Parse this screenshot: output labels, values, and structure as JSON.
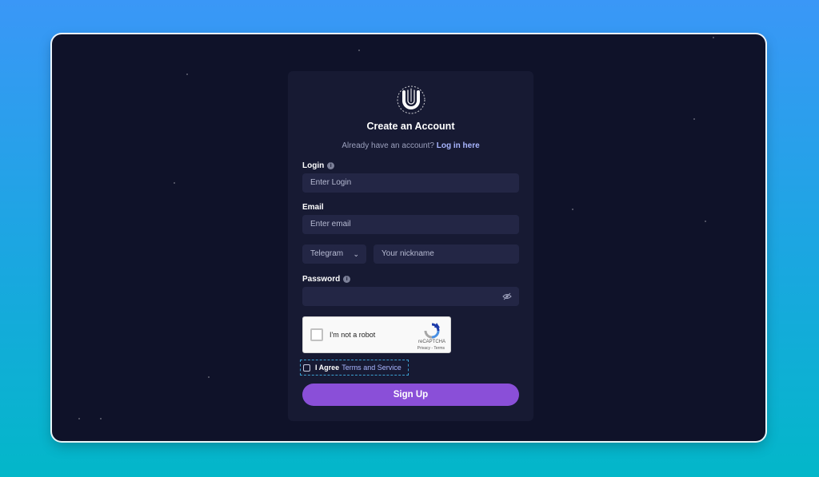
{
  "form": {
    "title": "Create an Account",
    "subtitle_text": "Already have an account?",
    "login_link": "Log in here",
    "login_label": "Login",
    "login_placeholder": "Enter Login",
    "email_label": "Email",
    "email_placeholder": "Enter email",
    "messenger_selected": "Telegram",
    "nickname_placeholder": "Your nickname",
    "password_label": "Password",
    "password_value": "",
    "agree_text": "I Agree",
    "terms_link": "Terms and Service",
    "signup_label": "Sign Up"
  },
  "recaptcha": {
    "label": "I'm not a robot",
    "brand": "reCAPTCHA",
    "links": "Privacy - Terms"
  },
  "icons": {
    "logo": "brand-logo-icon",
    "info": "info-icon",
    "chevron": "chevron-down-icon",
    "eye": "eye-off-icon",
    "recaptcha": "recaptcha-logo-icon"
  },
  "colors": {
    "accent": "#8a4fd8",
    "link": "#a9b6ff",
    "card": "#171a33",
    "window": "#0f1229",
    "field": "#232645"
  }
}
